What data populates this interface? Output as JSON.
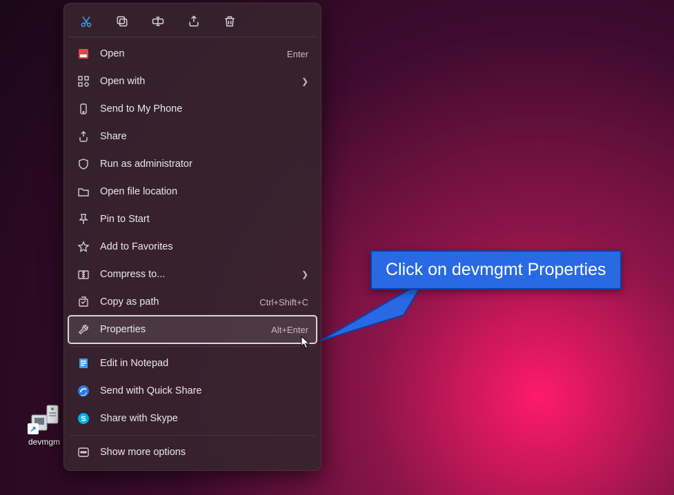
{
  "desktop": {
    "icon_label": "devmgm"
  },
  "action_bar": {
    "cut": "cut",
    "copy": "copy",
    "rename": "rename",
    "share": "share",
    "delete": "delete"
  },
  "menu": {
    "open": {
      "label": "Open",
      "accel": "Enter"
    },
    "open_with": {
      "label": "Open with"
    },
    "send_phone": {
      "label": "Send to My Phone"
    },
    "share": {
      "label": "Share"
    },
    "run_admin": {
      "label": "Run as administrator"
    },
    "open_location": {
      "label": "Open file location"
    },
    "pin_start": {
      "label": "Pin to Start"
    },
    "favorites": {
      "label": "Add to Favorites"
    },
    "compress": {
      "label": "Compress to..."
    },
    "copy_path": {
      "label": "Copy as path",
      "accel": "Ctrl+Shift+C"
    },
    "properties": {
      "label": "Properties",
      "accel": "Alt+Enter"
    },
    "edit_notepad": {
      "label": "Edit in Notepad"
    },
    "quick_share": {
      "label": "Send with Quick Share"
    },
    "skype": {
      "label": "Share with Skype"
    },
    "more": {
      "label": "Show more options"
    }
  },
  "callout": {
    "text": "Click on devmgmt Properties"
  }
}
